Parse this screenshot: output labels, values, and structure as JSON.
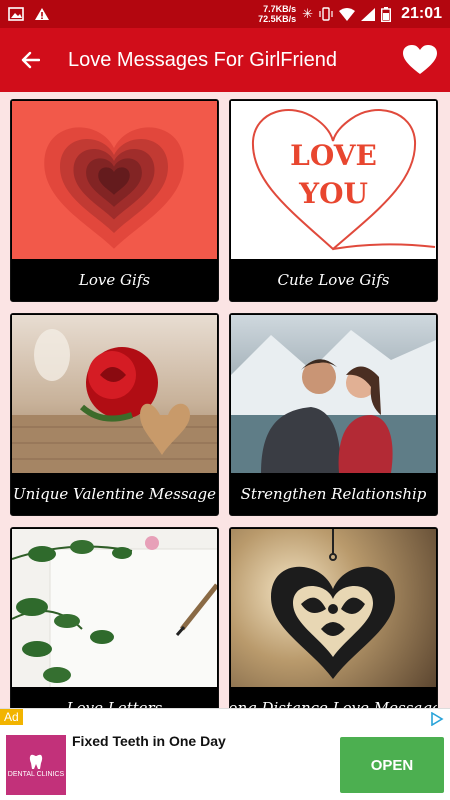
{
  "status_bar": {
    "net_up": "7.7KB/s",
    "net_down": "72.5KB/s",
    "time": "21:01"
  },
  "app_bar": {
    "title": "Love Messages For GirlFriend",
    "back_icon": "arrow-left-icon",
    "favorite_icon": "heart-icon"
  },
  "categories": [
    {
      "label": "Love Gifs"
    },
    {
      "label": "Cute Love Gifs",
      "image_text_line1": "LOVE",
      "image_text_line2": "YOU"
    },
    {
      "label": "Unique Valentine Message"
    },
    {
      "label": "Strengthen Relationship"
    },
    {
      "label": "Love Letters"
    },
    {
      "label": "Long Distance Love Messages"
    }
  ],
  "ad": {
    "tag": "Ad",
    "title": "Fixed Teeth in One Day",
    "logo_text": "DENTAL CLINICS",
    "button": "OPEN"
  },
  "colors": {
    "status_bar": "#b3060f",
    "app_bar": "#d10d1a",
    "background": "#fbe4e4",
    "ad_button": "#4caf50"
  }
}
